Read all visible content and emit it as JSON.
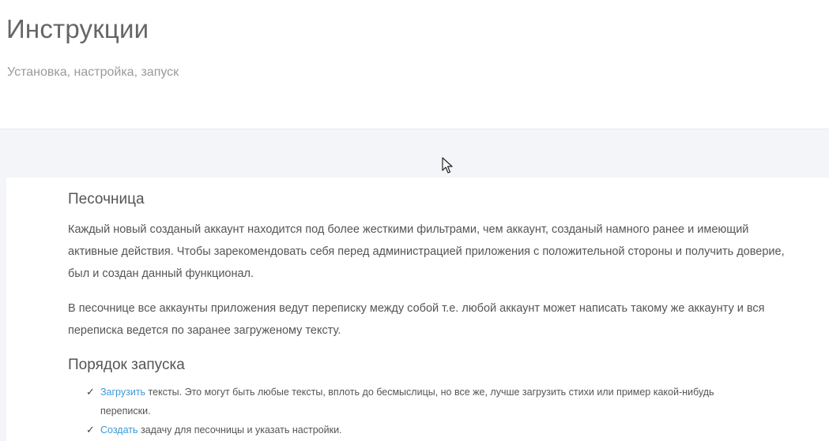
{
  "header": {
    "title": "Инструкции",
    "subtitle": "Установка, настройка, запуск"
  },
  "sandbox": {
    "title": "Песочница",
    "paragraphs": [
      "Каждый новый созданый аккаунт находится под более жесткими фильтрами, чем аккаунт, созданый намного ранее и имеющий активные действия. Чтобы зарекомендовать себя перед администрацией приложения с положительной стороны и получить доверие, был и создан данный функционал.",
      "В песочнице все аккаунты приложения ведут переписку между собой т.е. любой аккаунт может написать такому же аккаунту и вся переписка ведется по заранее загруженому тексту."
    ]
  },
  "launch": {
    "title": "Порядок запуска",
    "steps": [
      {
        "link": "Загрузить",
        "text": " тексты. Это могут быть любые тексты, вплоть до бесмыслицы, но все же, лучше загрузить стихи или пример какой-нибудь переписки."
      },
      {
        "link": "Создать",
        "text": " задачу для песочницы и указать настройки."
      }
    ],
    "check_glyph": "✓"
  },
  "colors": {
    "link": "#3a9ad9",
    "band": "#f4f5f8"
  }
}
